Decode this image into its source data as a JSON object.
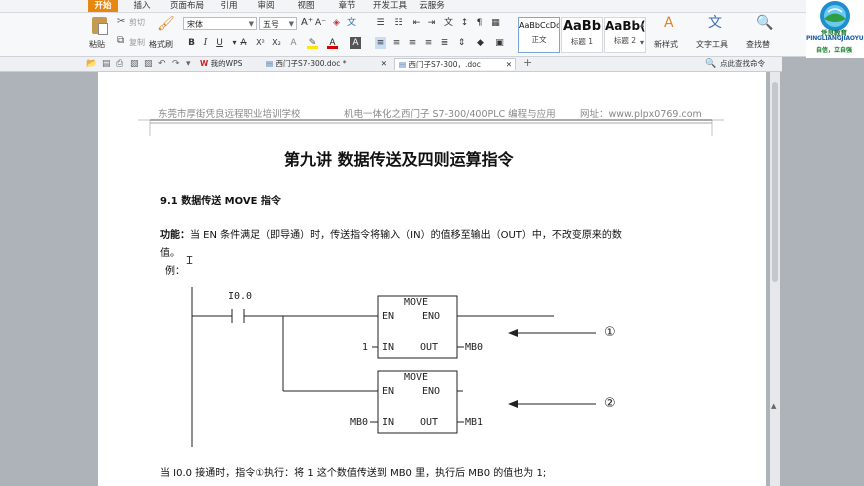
{
  "tabs": [
    "开始",
    "插入",
    "页面布局",
    "引用",
    "审阅",
    "视图",
    "章节",
    "开发工具",
    "云服务"
  ],
  "ribbon": {
    "paste": "粘贴",
    "cut": "剪切",
    "copy": "复制",
    "format_painter": "格式刷",
    "font_name": "宋体",
    "font_size": "五号",
    "styles": [
      {
        "sample": "AaBbCcDd",
        "name": "正文"
      },
      {
        "sample": "AaBb",
        "name": "标题 1"
      },
      {
        "sample": "AaBb(",
        "name": "标题 2"
      }
    ],
    "new_style": "新样式",
    "text_tools": "文字工具",
    "find_replace": "查找替"
  },
  "doc_tabs": [
    {
      "label": "我的WPS"
    },
    {
      "label": "西门子S7-300.doc *"
    },
    {
      "label": "西门子S7-300，.doc"
    }
  ],
  "doc_tabs_search": "点此查找命令",
  "logo": {
    "line1": "凭良教育",
    "line2": "PINGLIANGJIAOYU",
    "line3": "自信，立自强"
  },
  "document": {
    "header_left": "东莞市厚街凭良远程职业培训学校",
    "header_center": "机电一体化之西门子 S7-300/400PLC 编程与应用",
    "header_right": "网址：www.plpx0769.com",
    "title": "第九讲   数据传送及四则运算指令",
    "section_heading": "9.1    数据传送 MOVE 指令",
    "func_label": "功能：",
    "func_text": "当 EN 条件满足（即导通）时，传送指令将输入（IN）的值移至输出（OUT）中，不改变原来的数",
    "func_text2": "值。",
    "example_label": "例：",
    "bottom_text": "当 I0.0 接通时，指令①执行：将 1 这个数值传送到 MB0 里，执行后 MB0 的值也为 1;"
  },
  "ladder": {
    "contact": "I0.0",
    "box1": {
      "title": "MOVE",
      "en": "EN",
      "eno": "ENO",
      "in": "IN",
      "out": "OUT",
      "in_value": "1",
      "out_value": "MB0"
    },
    "box2": {
      "title": "MOVE",
      "en": "EN",
      "eno": "ENO",
      "in": "IN",
      "out": "OUT",
      "in_value": "MB0",
      "out_value": "MB1"
    },
    "marker1": "①",
    "marker2": "②"
  }
}
